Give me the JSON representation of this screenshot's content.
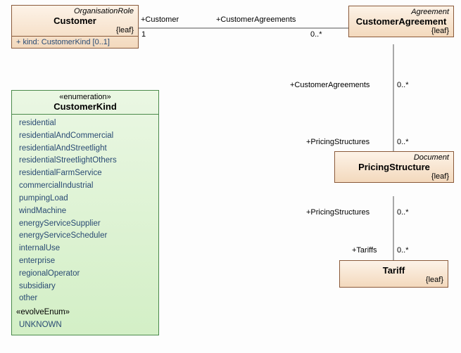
{
  "customer": {
    "stereotype": "OrganisationRole",
    "name": "Customer",
    "constraint": "{leaf}",
    "attribute": "+   kind: CustomerKind [0..1]"
  },
  "customerAgreement": {
    "stereotype": "Agreement",
    "name": "CustomerAgreement",
    "constraint": "{leaf}"
  },
  "pricingStructure": {
    "stereotype": "Document",
    "name": "PricingStructure",
    "constraint": "{leaf}"
  },
  "tariff": {
    "name": "Tariff",
    "constraint": "{leaf}"
  },
  "customerKind": {
    "stereotype": "«enumeration»",
    "name": "CustomerKind",
    "literals": [
      "residential",
      "residentialAndCommercial",
      "residentialAndStreetlight",
      "residentialStreetlightOthers",
      "residentialFarmService",
      "commercialIndustrial",
      "pumpingLoad",
      "windMachine",
      "energyServiceSupplier",
      "energyServiceScheduler",
      "internalUse",
      "enterprise",
      "regionalOperator",
      "subsidiary",
      "other"
    ],
    "section": "«evolveEnum»",
    "extra": "UNKNOWN"
  },
  "labels": {
    "customerRole": "+Customer",
    "customerMult": "1",
    "customerAgreementsRole": "+CustomerAgreements",
    "zeroMany": "0..*",
    "pricingStructuresRole": "+PricingStructures",
    "tariffsRole": "+Tariffs"
  }
}
